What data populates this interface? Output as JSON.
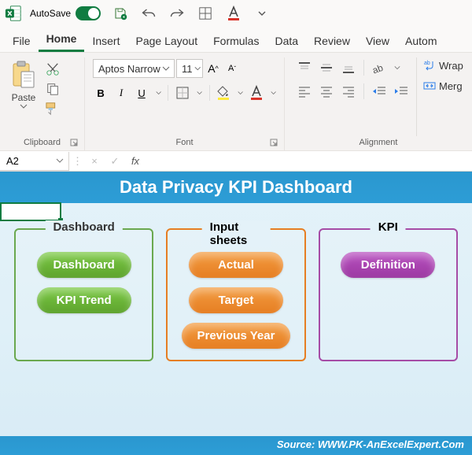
{
  "titlebar": {
    "autosave_label": "AutoSave",
    "autosave_toggle": "On"
  },
  "tabs": [
    "File",
    "Home",
    "Insert",
    "Page Layout",
    "Formulas",
    "Data",
    "Review",
    "View",
    "Autom"
  ],
  "active_tab": "Home",
  "ribbon": {
    "clipboard": {
      "paste": "Paste",
      "label": "Clipboard"
    },
    "font": {
      "name": "Aptos Narrow",
      "size": "11",
      "label": "Font"
    },
    "alignment": {
      "wrap": "Wrap",
      "merge": "Merg",
      "label": "Alignment"
    }
  },
  "formula_bar": {
    "name_box": "A2",
    "fx_label": "fx",
    "value": ""
  },
  "dashboard": {
    "title": "Data Privacy KPI Dashboard",
    "cols": [
      {
        "title": "Dashboard",
        "theme": "green",
        "buttons": [
          "Dashboard",
          "KPI Trend"
        ]
      },
      {
        "title": "Input sheets",
        "theme": "orange",
        "buttons": [
          "Actual",
          "Target",
          "Previous Year"
        ]
      },
      {
        "title": "KPI",
        "theme": "purple",
        "buttons": [
          "Definition"
        ]
      }
    ],
    "source": "Source: WWW.PK-AnExcelExpert.Com"
  }
}
